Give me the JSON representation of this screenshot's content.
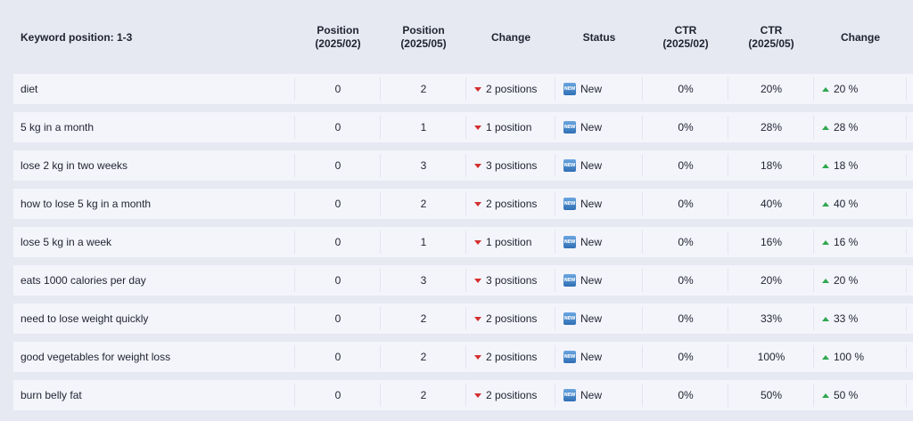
{
  "header": {
    "keyword": "Keyword position:  1-3",
    "position_feb_line1": "Position",
    "position_feb_line2": "(2025/02)",
    "position_may_line1": "Position",
    "position_may_line2": "(2025/05)",
    "change": "Change",
    "status": "Status",
    "ctr_feb_line1": "CTR",
    "ctr_feb_line2": "(2025/02)",
    "ctr_may_line1": "CTR",
    "ctr_may_line2": "(2025/05)",
    "ctr_change": "Change"
  },
  "colors": {
    "down": "#d32f2f",
    "up": "#2fa84f",
    "row_bg": "#f4f5fb",
    "page_bg": "#e6e8f2"
  },
  "icons": {
    "change_down": "red-triangle-down-icon",
    "change_up": "green-triangle-up-icon",
    "status_new": "new-badge-icon"
  },
  "rows": [
    {
      "keyword": "diet",
      "pos_feb": "0",
      "pos_may": "2",
      "change": "2 positions",
      "status": "New",
      "ctr_feb": "0%",
      "ctr_may": "20%",
      "ctr_change": "20 %"
    },
    {
      "keyword": "5 kg in a month",
      "pos_feb": "0",
      "pos_may": "1",
      "change": "1 position",
      "status": "New",
      "ctr_feb": "0%",
      "ctr_may": "28%",
      "ctr_change": "28 %"
    },
    {
      "keyword": "lose 2 kg in two weeks",
      "pos_feb": "0",
      "pos_may": "3",
      "change": "3 positions",
      "status": "New",
      "ctr_feb": "0%",
      "ctr_may": "18%",
      "ctr_change": "18 %"
    },
    {
      "keyword": "how to lose 5 kg in a month",
      "pos_feb": "0",
      "pos_may": "2",
      "change": "2 positions",
      "status": "New",
      "ctr_feb": "0%",
      "ctr_may": "40%",
      "ctr_change": "40 %"
    },
    {
      "keyword": "lose 5 kg in a week",
      "pos_feb": "0",
      "pos_may": "1",
      "change": "1 position",
      "status": "New",
      "ctr_feb": "0%",
      "ctr_may": "16%",
      "ctr_change": "16 %"
    },
    {
      "keyword": "eats 1000 calories per day",
      "pos_feb": "0",
      "pos_may": "3",
      "change": "3 positions",
      "status": "New",
      "ctr_feb": "0%",
      "ctr_may": "20%",
      "ctr_change": "20 %"
    },
    {
      "keyword": "need to lose weight quickly",
      "pos_feb": "0",
      "pos_may": "2",
      "change": "2 positions",
      "status": "New",
      "ctr_feb": "0%",
      "ctr_may": "33%",
      "ctr_change": "33 %"
    },
    {
      "keyword": "good vegetables for weight loss",
      "pos_feb": "0",
      "pos_may": "2",
      "change": "2 positions",
      "status": "New",
      "ctr_feb": "0%",
      "ctr_may": "100%",
      "ctr_change": "100 %"
    },
    {
      "keyword": "burn belly fat",
      "pos_feb": "0",
      "pos_may": "2",
      "change": "2 positions",
      "status": "New",
      "ctr_feb": "0%",
      "ctr_may": "50%",
      "ctr_change": "50 %"
    }
  ]
}
